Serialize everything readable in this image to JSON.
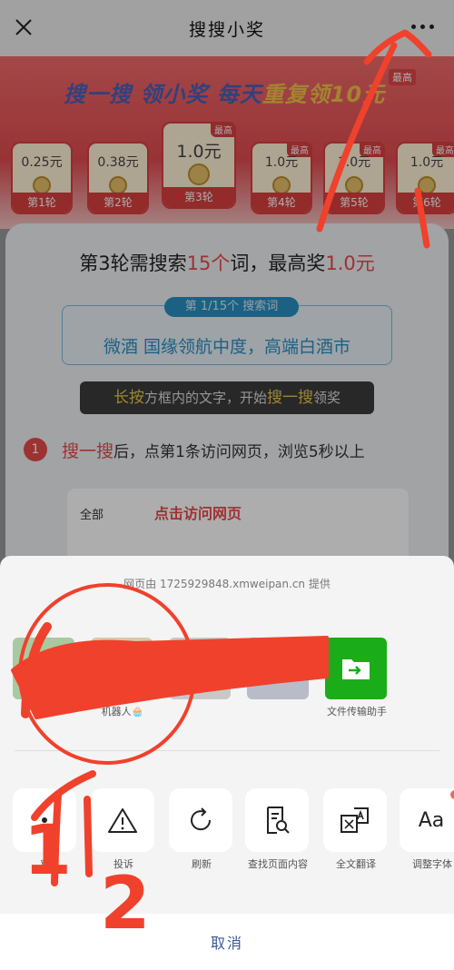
{
  "topbar": {
    "title": "搜搜小奖"
  },
  "banner": {
    "title_part1": "搜一搜 领小奖 每天",
    "title_part2": "重复领10元",
    "badge": "最高"
  },
  "rounds": [
    {
      "amount": "0.25元",
      "label": "第1轮",
      "tag": ""
    },
    {
      "amount": "0.38元",
      "label": "第2轮",
      "tag": ""
    },
    {
      "amount": "1.0元",
      "label": "第3轮",
      "tag": "最高"
    },
    {
      "amount": "1.0元",
      "label": "第4轮",
      "tag": "最高"
    },
    {
      "amount": "1.0元",
      "label": "第5轮",
      "tag": "最高"
    },
    {
      "amount": "1.0元",
      "label": "第6轮",
      "tag": "最高"
    }
  ],
  "round_info": {
    "p1": "第3轮需搜索",
    "count": "15个",
    "p2": "词，最高奖",
    "prize": "1.0元"
  },
  "keyword": {
    "tag": "第 1/15个 搜索词",
    "text": "微酒 国缘领航中度，高端白酒市"
  },
  "hint": {
    "p1": "长按",
    "p2": "方框内的文字，开始",
    "p3": "搜一搜",
    "p4": "领奖"
  },
  "step1": {
    "num": "1",
    "p1": "搜一搜",
    "p2": "后，点第1条访问网页，浏览5秒以上"
  },
  "preview": {
    "all": "全部",
    "visit": "点击访问网页"
  },
  "sheet": {
    "provider": "网页由 1725929848.xmweipan.cn 提供",
    "contacts": [
      {
        "name": ""
      },
      {
        "name": "机器人🧁"
      },
      {
        "name": ""
      },
      {
        "name": ""
      },
      {
        "name": "文件传输助手"
      }
    ],
    "actions": [
      {
        "label": "窗",
        "icon": "floating-window-icon"
      },
      {
        "label": "投诉",
        "icon": "warning-icon"
      },
      {
        "label": "刷新",
        "icon": "refresh-icon"
      },
      {
        "label": "查找页面内容",
        "icon": "find-in-page-icon"
      },
      {
        "label": "全文翻译",
        "icon": "translate-icon"
      },
      {
        "label": "调整字体",
        "icon": "font-size-icon"
      }
    ],
    "cancel": "取消",
    "font_icon_text": "Aa"
  },
  "annotations": {
    "label1": "1",
    "label2": "2",
    "color": "#f0412c"
  }
}
